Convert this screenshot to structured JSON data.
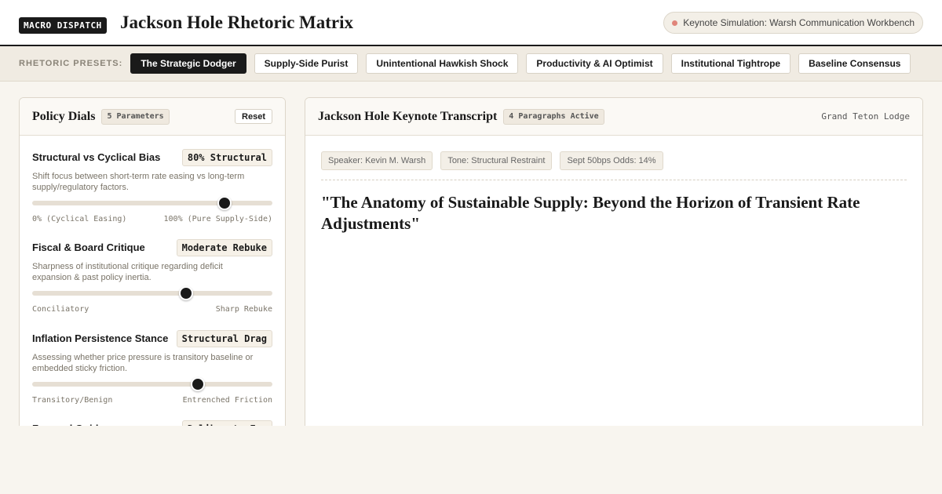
{
  "header": {
    "brand": "MACRO DISPATCH",
    "title": "Jackson Hole Rhetoric Matrix",
    "sim_label": "Keynote Simulation: Warsh Communication Workbench"
  },
  "presets": {
    "label": "RHETORIC PRESETS:",
    "items": [
      {
        "label": "The Strategic Dodger",
        "active": true
      },
      {
        "label": "Supply-Side Purist",
        "active": false
      },
      {
        "label": "Unintentional Hawkish Shock",
        "active": false
      },
      {
        "label": "Productivity & AI Optimist",
        "active": false
      },
      {
        "label": "Institutional Tightrope",
        "active": false
      },
      {
        "label": "Baseline Consensus",
        "active": false
      }
    ]
  },
  "dials_panel": {
    "title": "Policy Dials",
    "badge": "5 Parameters",
    "reset_label": "Reset",
    "dials": [
      {
        "name": "Structural vs Cyclical Bias",
        "value": "80% Structural",
        "description": "Shift focus between short-term rate easing vs long-term supply/regulatory factors.",
        "range_lo": "0% (Cyclical Easing)",
        "range_hi": "100% (Pure Supply-Side)",
        "level": 0.8
      },
      {
        "name": "Fiscal & Board Critique",
        "value": "Moderate Rebuke",
        "description": "Sharpness of institutional critique regarding deficit expansion & past policy inertia.",
        "range_lo": "Conciliatory",
        "range_hi": "Sharp Rebuke",
        "level": 0.64
      },
      {
        "name": "Inflation Persistence Stance",
        "value": "Structural Drag",
        "description": "Assessing whether price pressure is transitory baseline or embedded sticky friction.",
        "range_lo": "Transitory/Benign",
        "range_hi": "Entrenched Friction",
        "level": 0.69
      },
      {
        "name": "Forward Guidance",
        "value": "Deliberate Fog"
      }
    ]
  },
  "transcript_panel": {
    "title": "Jackson Hole Keynote Transcript",
    "badge": "4 Paragraphs Active",
    "location": "Grand Teton Lodge",
    "meta": [
      "Speaker: Kevin M. Warsh",
      "Tone: Structural Restraint",
      "Sept 50bps Odds: 14%"
    ],
    "keynote_title": "\"The Anatomy of Sustainable Supply: Beyond the Horizon of Transient Rate Adjustments\""
  },
  "colors": {
    "accent": "#1a1a1a",
    "background": "#f8f5ef",
    "status_dot": "#e0857a"
  }
}
